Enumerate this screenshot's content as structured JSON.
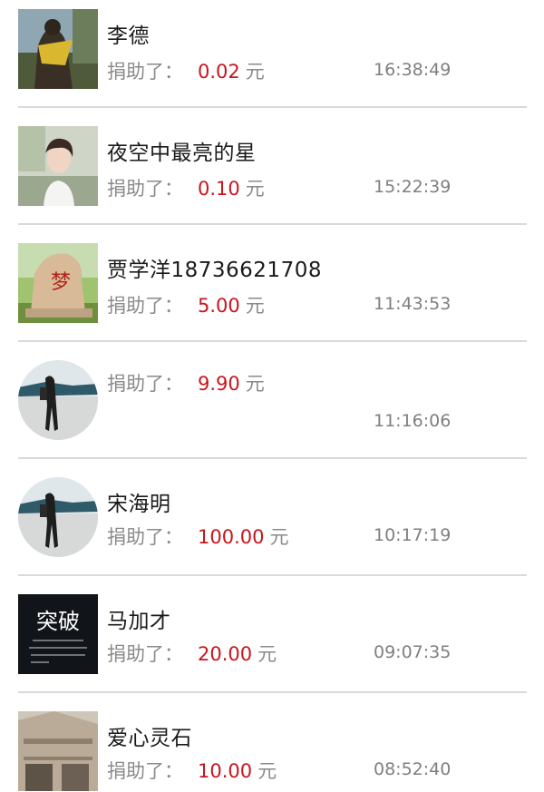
{
  "donations": [
    {
      "name": "李德",
      "label": "捐助了：",
      "amount": "0.02",
      "unit": "元",
      "time": "16:38:49",
      "avatar": "statue-photo-avatar"
    },
    {
      "name": "夜空中最亮的星",
      "label": "捐助了：",
      "amount": "0.10",
      "unit": "元",
      "time": "15:22:39",
      "avatar": "young-man-portrait-avatar"
    },
    {
      "name": "贾学洋18736621708",
      "label": "捐助了：",
      "amount": "5.00",
      "unit": "元",
      "time": "11:43:53",
      "avatar": "dream-stone-avatar"
    },
    {
      "name": "",
      "label": "捐助了：",
      "amount": "9.90",
      "unit": "元",
      "time": "11:16:06",
      "avatar": "walking-man-avatar"
    },
    {
      "name": "宋海明",
      "label": "捐助了：",
      "amount": "100.00",
      "unit": "元",
      "time": "10:17:19",
      "avatar": "walking-man-avatar"
    },
    {
      "name": "马加才",
      "label": "捐助了：",
      "amount": "20.00",
      "unit": "元",
      "time": "09:07:35",
      "avatar": "breakthrough-text-avatar"
    },
    {
      "name": "爱心灵石",
      "label": "捐助了：",
      "amount": "10.00",
      "unit": "元",
      "time": "08:52:40",
      "avatar": "building-photo-avatar"
    }
  ],
  "avatar_text": {
    "dream_glyph": "梦",
    "breakthrough": "突破"
  },
  "colors": {
    "amount": "#c8161d",
    "label": "#8a8a8a",
    "divider": "#d9d9d9"
  }
}
